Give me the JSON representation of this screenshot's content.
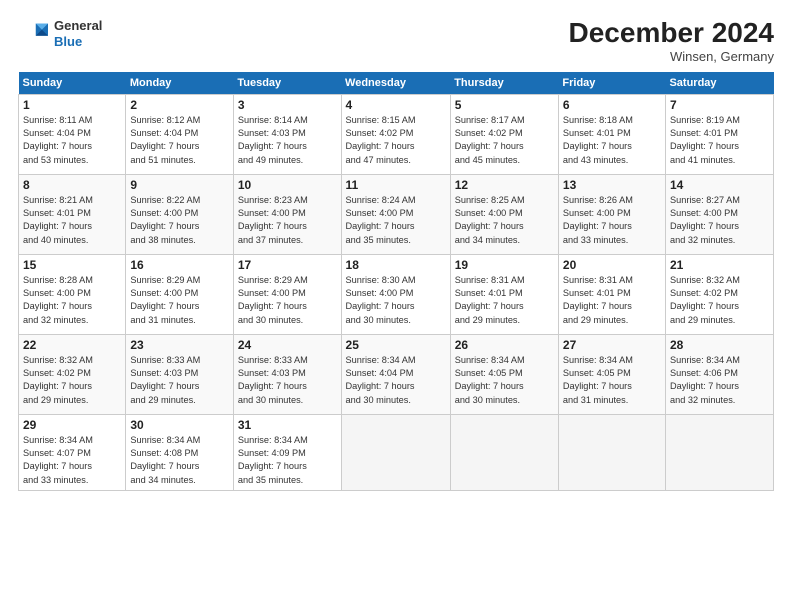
{
  "logo": {
    "line1": "General",
    "line2": "Blue"
  },
  "title": "December 2024",
  "location": "Winsen, Germany",
  "headers": [
    "Sunday",
    "Monday",
    "Tuesday",
    "Wednesday",
    "Thursday",
    "Friday",
    "Saturday"
  ],
  "weeks": [
    [
      {
        "day": "1",
        "sunrise": "8:11 AM",
        "sunset": "4:04 PM",
        "daylight": "7 hours and 53 minutes."
      },
      {
        "day": "2",
        "sunrise": "8:12 AM",
        "sunset": "4:04 PM",
        "daylight": "7 hours and 51 minutes."
      },
      {
        "day": "3",
        "sunrise": "8:14 AM",
        "sunset": "4:03 PM",
        "daylight": "7 hours and 49 minutes."
      },
      {
        "day": "4",
        "sunrise": "8:15 AM",
        "sunset": "4:02 PM",
        "daylight": "7 hours and 47 minutes."
      },
      {
        "day": "5",
        "sunrise": "8:17 AM",
        "sunset": "4:02 PM",
        "daylight": "7 hours and 45 minutes."
      },
      {
        "day": "6",
        "sunrise": "8:18 AM",
        "sunset": "4:01 PM",
        "daylight": "7 hours and 43 minutes."
      },
      {
        "day": "7",
        "sunrise": "8:19 AM",
        "sunset": "4:01 PM",
        "daylight": "7 hours and 41 minutes."
      }
    ],
    [
      {
        "day": "8",
        "sunrise": "8:21 AM",
        "sunset": "4:01 PM",
        "daylight": "7 hours and 40 minutes."
      },
      {
        "day": "9",
        "sunrise": "8:22 AM",
        "sunset": "4:00 PM",
        "daylight": "7 hours and 38 minutes."
      },
      {
        "day": "10",
        "sunrise": "8:23 AM",
        "sunset": "4:00 PM",
        "daylight": "7 hours and 37 minutes."
      },
      {
        "day": "11",
        "sunrise": "8:24 AM",
        "sunset": "4:00 PM",
        "daylight": "7 hours and 35 minutes."
      },
      {
        "day": "12",
        "sunrise": "8:25 AM",
        "sunset": "4:00 PM",
        "daylight": "7 hours and 34 minutes."
      },
      {
        "day": "13",
        "sunrise": "8:26 AM",
        "sunset": "4:00 PM",
        "daylight": "7 hours and 33 minutes."
      },
      {
        "day": "14",
        "sunrise": "8:27 AM",
        "sunset": "4:00 PM",
        "daylight": "7 hours and 32 minutes."
      }
    ],
    [
      {
        "day": "15",
        "sunrise": "8:28 AM",
        "sunset": "4:00 PM",
        "daylight": "7 hours and 32 minutes."
      },
      {
        "day": "16",
        "sunrise": "8:29 AM",
        "sunset": "4:00 PM",
        "daylight": "7 hours and 31 minutes."
      },
      {
        "day": "17",
        "sunrise": "8:29 AM",
        "sunset": "4:00 PM",
        "daylight": "7 hours and 30 minutes."
      },
      {
        "day": "18",
        "sunrise": "8:30 AM",
        "sunset": "4:00 PM",
        "daylight": "7 hours and 30 minutes."
      },
      {
        "day": "19",
        "sunrise": "8:31 AM",
        "sunset": "4:01 PM",
        "daylight": "7 hours and 29 minutes."
      },
      {
        "day": "20",
        "sunrise": "8:31 AM",
        "sunset": "4:01 PM",
        "daylight": "7 hours and 29 minutes."
      },
      {
        "day": "21",
        "sunrise": "8:32 AM",
        "sunset": "4:02 PM",
        "daylight": "7 hours and 29 minutes."
      }
    ],
    [
      {
        "day": "22",
        "sunrise": "8:32 AM",
        "sunset": "4:02 PM",
        "daylight": "7 hours and 29 minutes."
      },
      {
        "day": "23",
        "sunrise": "8:33 AM",
        "sunset": "4:03 PM",
        "daylight": "7 hours and 29 minutes."
      },
      {
        "day": "24",
        "sunrise": "8:33 AM",
        "sunset": "4:03 PM",
        "daylight": "7 hours and 30 minutes."
      },
      {
        "day": "25",
        "sunrise": "8:34 AM",
        "sunset": "4:04 PM",
        "daylight": "7 hours and 30 minutes."
      },
      {
        "day": "26",
        "sunrise": "8:34 AM",
        "sunset": "4:05 PM",
        "daylight": "7 hours and 30 minutes."
      },
      {
        "day": "27",
        "sunrise": "8:34 AM",
        "sunset": "4:05 PM",
        "daylight": "7 hours and 31 minutes."
      },
      {
        "day": "28",
        "sunrise": "8:34 AM",
        "sunset": "4:06 PM",
        "daylight": "7 hours and 32 minutes."
      }
    ],
    [
      {
        "day": "29",
        "sunrise": "8:34 AM",
        "sunset": "4:07 PM",
        "daylight": "7 hours and 33 minutes."
      },
      {
        "day": "30",
        "sunrise": "8:34 AM",
        "sunset": "4:08 PM",
        "daylight": "7 hours and 34 minutes."
      },
      {
        "day": "31",
        "sunrise": "8:34 AM",
        "sunset": "4:09 PM",
        "daylight": "7 hours and 35 minutes."
      },
      null,
      null,
      null,
      null
    ]
  ],
  "labels": {
    "sunrise_prefix": "Sunrise: ",
    "sunset_prefix": "Sunset: ",
    "daylight_prefix": "Daylight: "
  }
}
